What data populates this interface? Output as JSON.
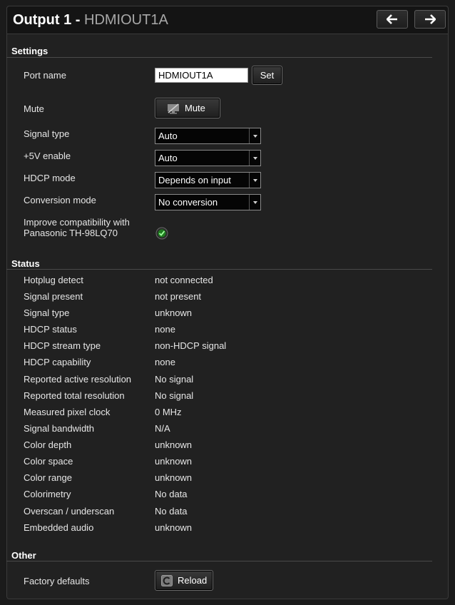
{
  "header": {
    "title": "Output 1",
    "separator": " - ",
    "port": "HDMIOUT1A",
    "prev_icon": "arrow-left-icon",
    "next_icon": "arrow-right-icon"
  },
  "settings": {
    "title": "Settings",
    "port_name": {
      "label": "Port name",
      "value": "HDMIOUT1A",
      "set_label": "Set"
    },
    "mute": {
      "label": "Mute",
      "button_label": "Mute",
      "icon": "mute-monitor-icon"
    },
    "signal_type": {
      "label": "Signal type",
      "value": "Auto"
    },
    "plus5v": {
      "label": "+5V enable",
      "value": "Auto"
    },
    "hdcp_mode": {
      "label": "HDCP mode",
      "value": "Depends on input"
    },
    "conversion_mode": {
      "label": "Conversion mode",
      "value": "No conversion"
    },
    "compat": {
      "label_line1": "Improve compatibility with",
      "label_line2": "Panasonic TH-98LQ70",
      "checked": true
    }
  },
  "status": {
    "title": "Status",
    "rows": [
      {
        "label": "Hotplug detect",
        "value": "not connected"
      },
      {
        "label": "Signal present",
        "value": "not present"
      },
      {
        "label": "Signal type",
        "value": "unknown"
      },
      {
        "label": "HDCP status",
        "value": "none"
      },
      {
        "label": "HDCP stream type",
        "value": "non-HDCP signal"
      },
      {
        "label": "HDCP capability",
        "value": "none"
      },
      {
        "label": "Reported active resolution",
        "value": "No signal"
      },
      {
        "label": "Reported total resolution",
        "value": "No signal"
      },
      {
        "label": "Measured pixel clock",
        "value": "0 MHz"
      },
      {
        "label": "Signal bandwidth",
        "value": "N/A"
      },
      {
        "label": "Color depth",
        "value": "unknown"
      },
      {
        "label": "Color space",
        "value": "unknown"
      },
      {
        "label": "Color range",
        "value": "unknown"
      },
      {
        "label": "Colorimetry",
        "value": "No data"
      },
      {
        "label": "Overscan / underscan",
        "value": "No data"
      },
      {
        "label": "Embedded audio",
        "value": "unknown"
      }
    ]
  },
  "other": {
    "title": "Other",
    "factory_defaults": {
      "label": "Factory defaults",
      "button_label": "Reload",
      "icon": "reload-icon"
    }
  },
  "colors": {
    "check_green": "#3cc23c",
    "panel_bg": "#212121",
    "header_bg": "#141414"
  }
}
